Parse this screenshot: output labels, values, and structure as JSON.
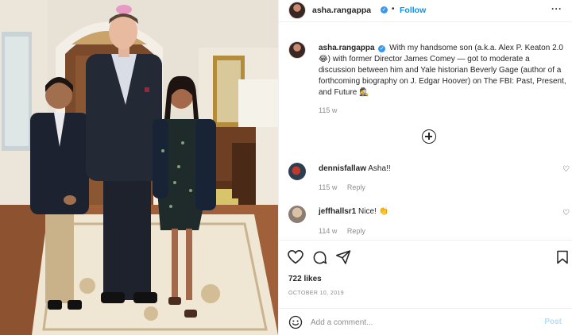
{
  "post": {
    "username": "asha.rangappa",
    "follow_label": "Follow",
    "separator": "•",
    "more_label": "···",
    "caption_username": "asha.rangappa",
    "caption_text": "With my handsome son (a.k.a. Alex P. Keaton 2.0 😂) with former Director James Comey — got to moderate a discussion between him and Yale historian Beverly Gage (author of a forthcoming biography on J. Edgar Hoover) on The FBI: Past, Present, and Future 🕵️",
    "caption_time": "115 w",
    "likes": "722 likes",
    "date": "OCTOBER 10, 2019"
  },
  "comments": [
    {
      "username": "dennisfallaw",
      "text": "Asha!!",
      "time": "115 w",
      "reply_label": "Reply"
    },
    {
      "username": "jeffhallsr1",
      "text": "Nice! 👏",
      "time": "114 w",
      "reply_label": "Reply"
    }
  ],
  "add_comment": {
    "placeholder": "Add a comment...",
    "post_label": "Post"
  },
  "icons": {
    "load_more": "plus-circle-icon",
    "like": "heart-icon",
    "comment": "comment-icon",
    "share": "share-icon",
    "save": "bookmark-icon",
    "emoji": "smiley-icon"
  },
  "colors": {
    "accent": "#0095f6",
    "verified": "#3897f0",
    "text": "#262626",
    "muted": "#8e8e8e"
  }
}
